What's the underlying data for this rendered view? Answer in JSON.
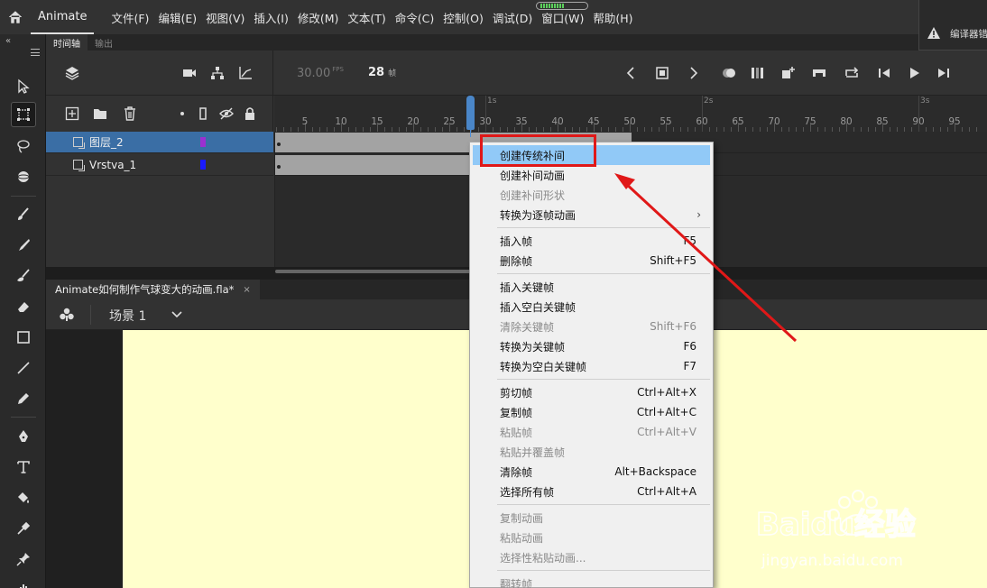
{
  "app": {
    "name": "Animate"
  },
  "menu": [
    "文件(F)",
    "编辑(E)",
    "视图(V)",
    "插入(I)",
    "修改(M)",
    "文本(T)",
    "命令(C)",
    "控制(O)",
    "调试(D)",
    "窗口(W)",
    "帮助(H)"
  ],
  "warning": {
    "text": "编译器错"
  },
  "panel_tabs": [
    "时间轴",
    "输出"
  ],
  "timeline": {
    "fps": "30.00",
    "fps_unit": "FPS",
    "current_frame": "28",
    "frame_unit": "帧",
    "ruler_numbers": [
      "5",
      "10",
      "15",
      "20",
      "25",
      "30",
      "35",
      "40",
      "45",
      "50",
      "55",
      "60",
      "65",
      "70",
      "75",
      "80",
      "85",
      "90",
      "95"
    ],
    "second_marks": [
      "1s",
      "2s",
      "3s"
    ],
    "layers": [
      {
        "name": "图层_2",
        "color": "#9b30d0",
        "selected": true
      },
      {
        "name": "Vrstva_1",
        "color": "#1a1aff",
        "selected": false
      }
    ]
  },
  "document": {
    "tab": "Animate如何制作气球变大的动画.fla*",
    "close": "×",
    "scene": "场景 1"
  },
  "context_menu": {
    "items": [
      {
        "label": "创建传统补间",
        "shortcut": "",
        "disabled": false,
        "highlighted": true
      },
      {
        "label": "创建补间动画",
        "shortcut": "",
        "disabled": false
      },
      {
        "label": "创建补间形状",
        "shortcut": "",
        "disabled": true
      },
      {
        "label": "转换为逐帧动画",
        "shortcut": "",
        "disabled": false,
        "submenu": "›"
      },
      {
        "label": "插入帧",
        "shortcut": "F5",
        "disabled": false
      },
      {
        "label": "删除帧",
        "shortcut": "Shift+F5",
        "disabled": false
      },
      {
        "label": "插入关键帧",
        "shortcut": "",
        "disabled": false
      },
      {
        "label": "插入空白关键帧",
        "shortcut": "",
        "disabled": false
      },
      {
        "label": "清除关键帧",
        "shortcut": "Shift+F6",
        "disabled": true
      },
      {
        "label": "转换为关键帧",
        "shortcut": "F6",
        "disabled": false
      },
      {
        "label": "转换为空白关键帧",
        "shortcut": "F7",
        "disabled": false
      },
      {
        "label": "剪切帧",
        "shortcut": "Ctrl+Alt+X",
        "disabled": false
      },
      {
        "label": "复制帧",
        "shortcut": "Ctrl+Alt+C",
        "disabled": false
      },
      {
        "label": "粘贴帧",
        "shortcut": "Ctrl+Alt+V",
        "disabled": true
      },
      {
        "label": "粘贴并覆盖帧",
        "shortcut": "",
        "disabled": true
      },
      {
        "label": "清除帧",
        "shortcut": "Alt+Backspace",
        "disabled": false
      },
      {
        "label": "选择所有帧",
        "shortcut": "Ctrl+Alt+A",
        "disabled": false
      },
      {
        "label": "复制动画",
        "shortcut": "",
        "disabled": true
      },
      {
        "label": "粘贴动画",
        "shortcut": "",
        "disabled": true
      },
      {
        "label": "选择性粘贴动画...",
        "shortcut": "",
        "disabled": true
      },
      {
        "label": "翻转帧",
        "shortcut": "",
        "disabled": true
      }
    ]
  },
  "watermark": {
    "text": "Baidu经验",
    "url": "jingyan.baidu.com"
  },
  "colors": {
    "accent": "#4a86c8",
    "highlight": "#91c9f7",
    "stage": "#ffffcc",
    "annotation": "#e01818"
  }
}
